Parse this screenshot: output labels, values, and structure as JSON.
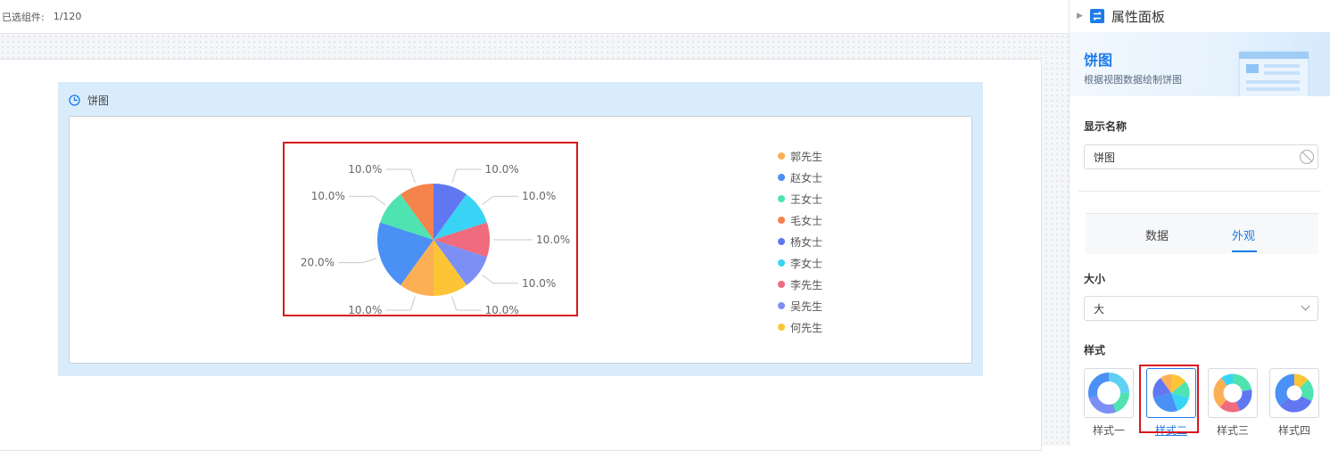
{
  "topbar": {
    "selected_label": "已选组件:",
    "selected_count": "1/120"
  },
  "widget": {
    "title": "饼图"
  },
  "colors": {
    "accent": "#1e7ce8",
    "highlight": "#d9161d",
    "widget_bg": "#d9ecfc"
  },
  "chart_data": {
    "type": "pie",
    "title": "",
    "slices": [
      {
        "label": "杨女士",
        "value": 10.0,
        "display": "10.0%",
        "color": "#6177f1"
      },
      {
        "label": "李女士",
        "value": 10.0,
        "display": "10.0%",
        "color": "#39d4f5"
      },
      {
        "label": "李先生",
        "value": 10.0,
        "display": "10.0%",
        "color": "#f06b7d"
      },
      {
        "label": "吴先生",
        "value": 10.0,
        "display": "10.0%",
        "color": "#7c8ff5"
      },
      {
        "label": "何先生",
        "value": 10.0,
        "display": "10.0%",
        "color": "#fdc535"
      },
      {
        "label": "郭先生",
        "value": 10.0,
        "display": "10.0%",
        "color": "#fcaf54"
      },
      {
        "label": "赵女士",
        "value": 20.0,
        "display": "20.0%",
        "color": "#4a90f5"
      },
      {
        "label": "王女士",
        "value": 10.0,
        "display": "10.0%",
        "color": "#4ee3b1"
      },
      {
        "label": "毛女士",
        "value": 10.0,
        "display": "10.0%",
        "color": "#f5834c"
      }
    ],
    "legend": [
      {
        "label": "郭先生",
        "color": "#fcaf54"
      },
      {
        "label": "赵女士",
        "color": "#4a90f5"
      },
      {
        "label": "王女士",
        "color": "#4ee3b1"
      },
      {
        "label": "毛女士",
        "color": "#f5834c"
      },
      {
        "label": "杨女士",
        "color": "#6177f1"
      },
      {
        "label": "李女士",
        "color": "#39d4f5"
      },
      {
        "label": "李先生",
        "color": "#f06b7d"
      },
      {
        "label": "吴先生",
        "color": "#7c8ff5"
      },
      {
        "label": "何先生",
        "color": "#fdc535"
      }
    ],
    "legend_position": "right"
  },
  "panel": {
    "header": "属性面板",
    "banner_title": "饼图",
    "banner_subtitle": "根据视图数据绘制饼图",
    "display_name_label": "显示名称",
    "display_name_value": "饼图",
    "tabs": [
      {
        "label": "数据",
        "active": false
      },
      {
        "label": "外观",
        "active": true
      }
    ],
    "size_label": "大小",
    "size_value": "大",
    "style_label": "样式",
    "styles": [
      {
        "label": "样式一",
        "icon": "donut-thin-icon",
        "selected": false
      },
      {
        "label": "样式二",
        "icon": "pie-icon",
        "selected": true
      },
      {
        "label": "样式三",
        "icon": "donut-icon",
        "selected": false
      },
      {
        "label": "样式四",
        "icon": "donut-thick-icon",
        "selected": false
      }
    ]
  }
}
